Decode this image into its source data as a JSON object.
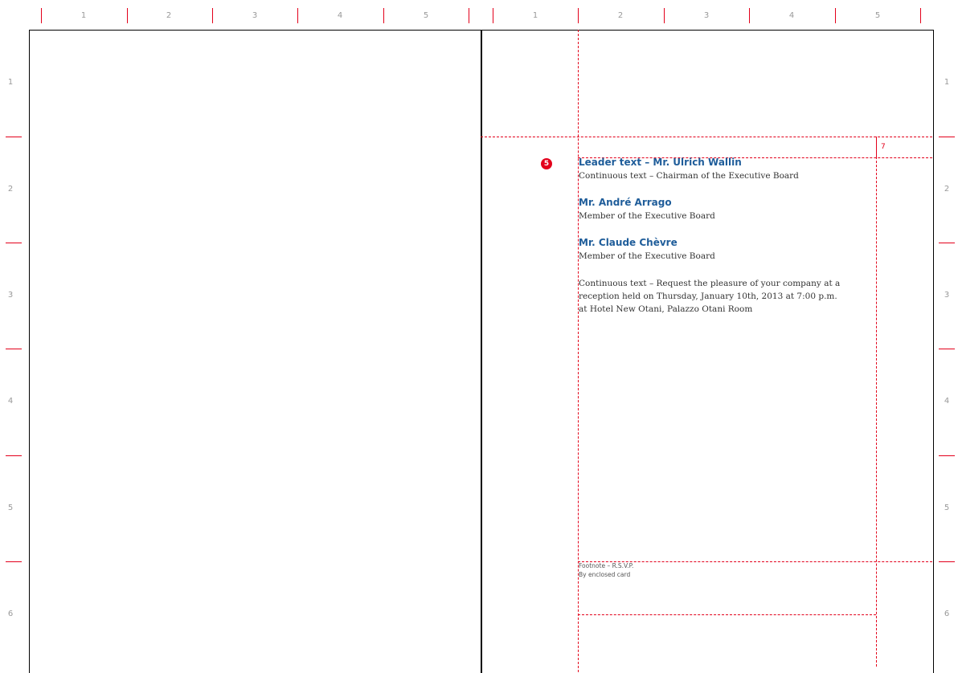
{
  "ruler_top": {
    "left_page": [
      "1",
      "2",
      "3",
      "4",
      "5"
    ],
    "right_page": [
      "1",
      "2",
      "3",
      "4",
      "5"
    ]
  },
  "ruler_side": {
    "left": [
      "1",
      "2",
      "3",
      "4",
      "5",
      "6"
    ],
    "right": [
      "1",
      "2",
      "3",
      "4",
      "5",
      "6"
    ]
  },
  "callout": {
    "badge": "5",
    "measure": "7"
  },
  "content": {
    "leader1": "Leader text – Mr. Ulrich Wallin",
    "sub1": "Continuous text – Chairman of the Executive Board",
    "leader2": "Mr. André Arrago",
    "sub2": "Member of the Executive Board",
    "leader3": "Mr. Claude Chèvre",
    "sub3": "Member of the Executive Board",
    "para_line1": "Continuous text – Request the pleasure of your company at a",
    "para_line2": "reception held on Thursday, January 10th, 2013 at 7:00 p.m.",
    "para_line3": "at Hotel New Otani, Palazzo Otani Room",
    "footnote1": "Footnote – R.S.V.P.",
    "footnote2": "By enclosed card"
  },
  "colors": {
    "guide": "#e3001b",
    "leader_text": "#1f5d9a",
    "body_text": "#333333"
  }
}
